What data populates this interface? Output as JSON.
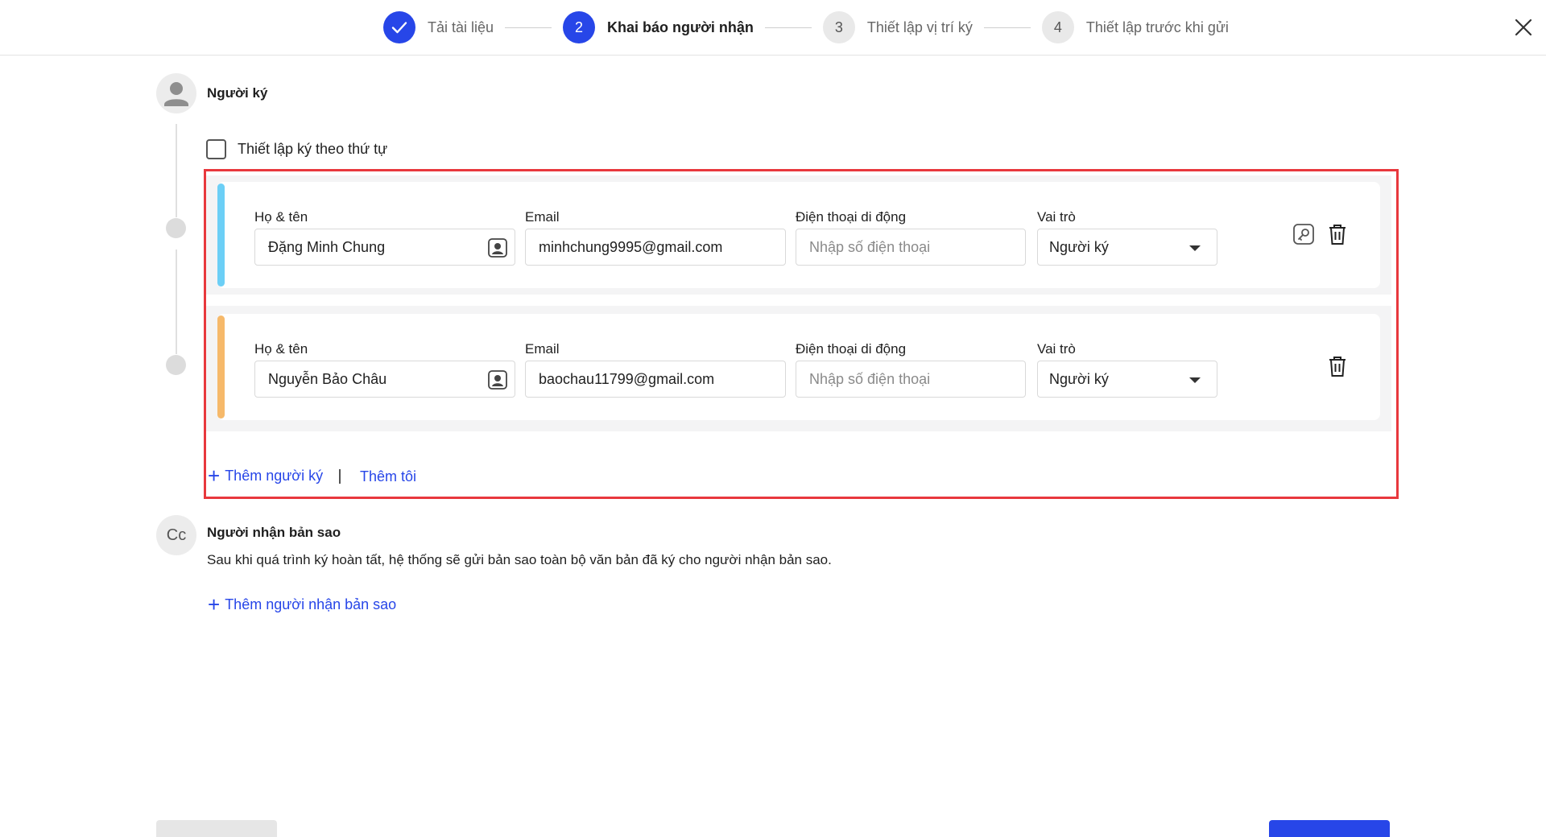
{
  "stepper": {
    "steps": [
      {
        "number": "",
        "label": "Tải tài liệu",
        "state": "done"
      },
      {
        "number": "2",
        "label": "Khai báo người nhận",
        "state": "active"
      },
      {
        "number": "3",
        "label": "Thiết lập vị trí ký",
        "state": "pending"
      },
      {
        "number": "4",
        "label": "Thiết lập trước khi gửi",
        "state": "pending"
      }
    ]
  },
  "signers_section": {
    "title": "Người ký",
    "order_checkbox_label": "Thiết lập ký theo thứ tự",
    "order_checked": false,
    "labels": {
      "name": "Họ & tên",
      "email": "Email",
      "phone": "Điện thoại di động",
      "role": "Vai trò"
    },
    "phone_placeholder": "Nhập số điện thoại",
    "signers": [
      {
        "name": "Đặng Minh Chung",
        "email": "minhchung9995@gmail.com",
        "phone": "",
        "role": "Người ký",
        "accent": "#6ccff6"
      },
      {
        "name": "Nguyễn Bảo Châu",
        "email": "baochau11799@gmail.com",
        "phone": "",
        "role": "Người ký",
        "accent": "#f6b96a"
      }
    ],
    "add_signer_label": "Thêm người ký",
    "add_me_label": "Thêm tôi"
  },
  "cc_section": {
    "avatar_text": "Cc",
    "title": "Người nhận bản sao",
    "description": "Sau khi quá trình ký hoàn tất, hệ thống sẽ gửi bản sao toàn bộ văn bản đã ký cho người nhận bản sao.",
    "add_cc_label": "Thêm người nhận bản sao"
  },
  "colors": {
    "primary": "#2746e8",
    "highlight": "#e8383d"
  }
}
